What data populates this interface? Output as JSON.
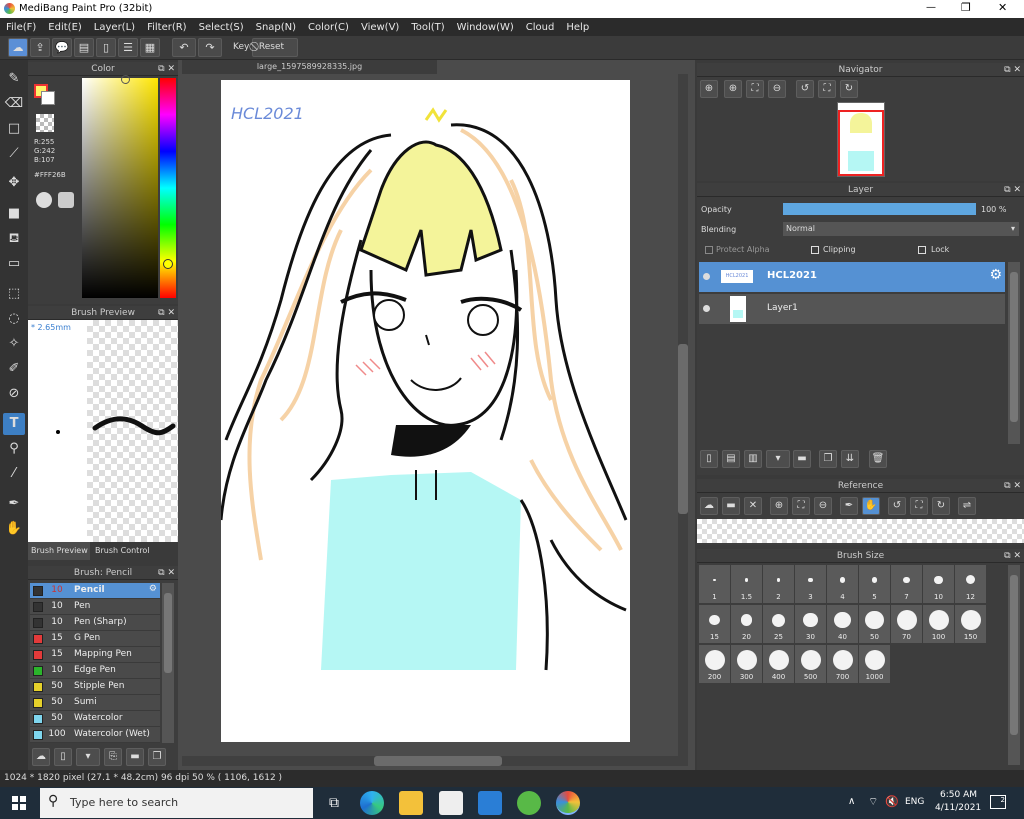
{
  "window": {
    "title": "MediBang Paint Pro (32bit)",
    "minimize": "—",
    "maximize": "❐",
    "close": "✕"
  },
  "menu": [
    "File(F)",
    "Edit(E)",
    "Layer(L)",
    "Filter(R)",
    "Select(S)",
    "Snap(N)",
    "Color(C)",
    "View(V)",
    "Tool(T)",
    "Window(W)",
    "Cloud",
    "Help"
  ],
  "toolbar": {
    "key_label": "Key",
    "reset_label": "Reset"
  },
  "color_panel": {
    "title": "Color",
    "r": "R:255",
    "g": "G:242",
    "b": "B:107",
    "hex": "#FFF26B",
    "primary": "#fff26b",
    "secondary": "#ffffff"
  },
  "brush_preview": {
    "title": "Brush Preview",
    "size": "* 2.65mm",
    "tab_preview": "Brush Preview",
    "tab_control": "Brush Control"
  },
  "brush_list": {
    "title": "Brush: Pencil",
    "items": [
      {
        "size": "10",
        "name": "Pencil",
        "color": "#333333"
      },
      {
        "size": "10",
        "name": "Pen",
        "color": "#333333"
      },
      {
        "size": "10",
        "name": "Pen (Sharp)",
        "color": "#333333"
      },
      {
        "size": "15",
        "name": "G Pen",
        "color": "#e33a3a"
      },
      {
        "size": "15",
        "name": "Mapping Pen",
        "color": "#e33a3a"
      },
      {
        "size": "10",
        "name": "Edge Pen",
        "color": "#2bb52b"
      },
      {
        "size": "50",
        "name": "Stipple Pen",
        "color": "#e6d12a"
      },
      {
        "size": "50",
        "name": "Sumi",
        "color": "#e6d12a"
      },
      {
        "size": "50",
        "name": "Watercolor",
        "color": "#7fd6ee"
      },
      {
        "size": "100",
        "name": "Watercolor (Wet)",
        "color": "#7fd6ee"
      }
    ]
  },
  "document": {
    "tab": "large_1597589928335.jpg",
    "signature": "HCL2021"
  },
  "navigator": {
    "title": "Navigator"
  },
  "layer_panel": {
    "title": "Layer",
    "opacity_label": "Opacity",
    "opacity_value": "100 %",
    "opacity_fraction": 1.0,
    "blending_label": "Blending",
    "blending_value": "Normal",
    "protect_alpha": "Protect Alpha",
    "clipping": "Clipping",
    "lock": "Lock",
    "layers": [
      {
        "name": "HCL2021",
        "thumb": "HCL2021"
      },
      {
        "name": "Layer1"
      }
    ]
  },
  "reference": {
    "title": "Reference"
  },
  "brush_size": {
    "title": "Brush Size",
    "sizes": [
      "1",
      "1.5",
      "2",
      "3",
      "4",
      "5",
      "7",
      "10",
      "12",
      "15",
      "20",
      "25",
      "30",
      "40",
      "50",
      "70",
      "100",
      "150",
      "200",
      "300",
      "400",
      "500",
      "700",
      "1000"
    ]
  },
  "status": {
    "text": "1024 * 1820 pixel  (27.1 * 48.2cm)  96 dpi  50 %  ( 1106, 1612 )"
  },
  "taskbar": {
    "search_placeholder": "Type here to search",
    "lang": "ENG",
    "time": "6:50 AM",
    "date": "4/11/2021",
    "notif": "2"
  }
}
